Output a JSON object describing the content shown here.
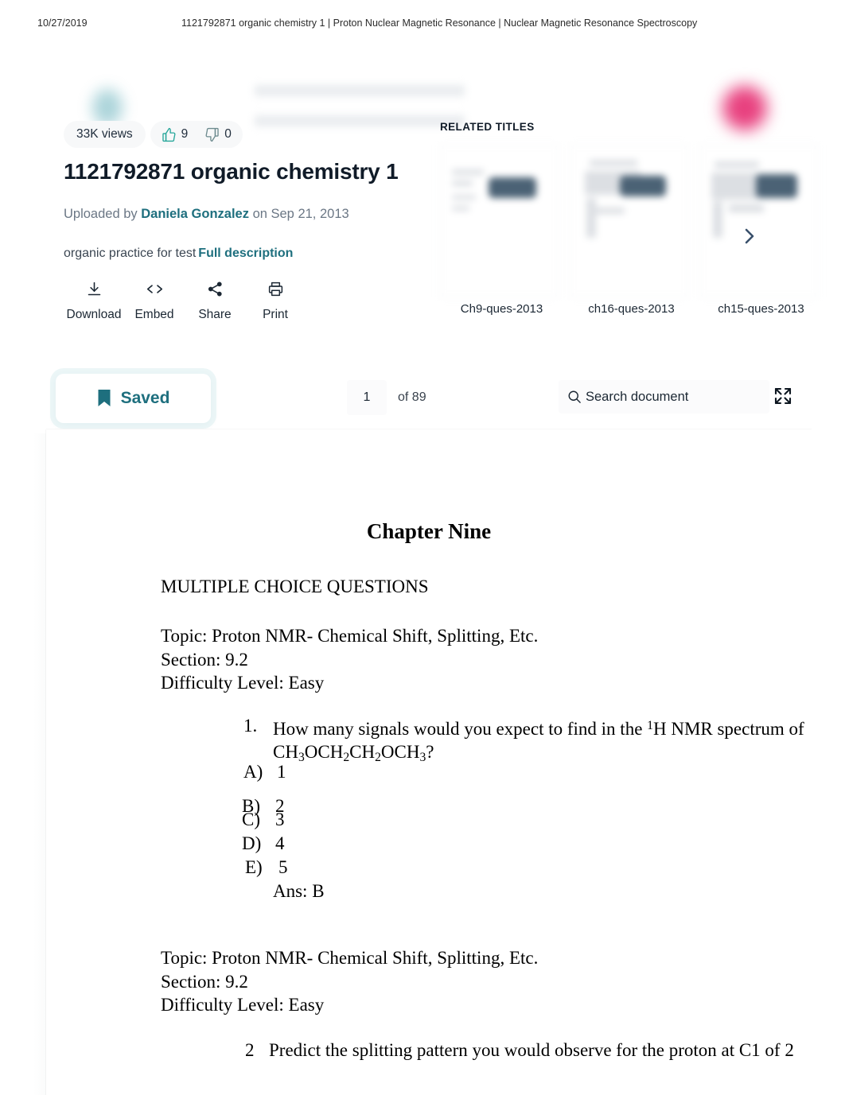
{
  "print_header": {
    "date": "10/27/2019",
    "title": "1121792871 organic chemistry 1 | Proton Nuclear Magnetic Resonance | Nuclear Magnetic Resonance Spectroscopy"
  },
  "stats": {
    "views": "33K views",
    "likes": "9",
    "dislikes": "0"
  },
  "document": {
    "title": "1121792871 organic chemistry 1",
    "uploaded_prefix": "Uploaded by",
    "author": "Daniela Gonzalez",
    "uploaded_suffix": "on Sep 21, 2013",
    "description": "organic practice for test",
    "full_description_link": "Full description"
  },
  "actions": [
    {
      "label": "Download",
      "icon": "download-icon"
    },
    {
      "label": "Embed",
      "icon": "code-icon"
    },
    {
      "label": "Share",
      "icon": "share-icon"
    },
    {
      "label": "Print",
      "icon": "printer-icon"
    }
  ],
  "related": {
    "heading": "RELATED TITLES",
    "items": [
      {
        "caption": "Ch9-ques-2013"
      },
      {
        "caption": "ch16-ques-2013"
      },
      {
        "caption": "ch15-ques-2013"
      }
    ],
    "next_icon": "chevron-right-icon"
  },
  "toolbar": {
    "saved_label": "Saved",
    "saved_icon": "bookmark-filled-icon",
    "page_number": "1",
    "page_total": "of 89",
    "search_placeholder": "Search document",
    "search_icon": "search-icon",
    "fullscreen_icon": "fullscreen-icon"
  },
  "page_content": {
    "chapter_title": "Chapter Nine",
    "section_heading": "MULTIPLE CHOICE QUESTIONS",
    "topic_block_1": {
      "topic": "Topic: Proton NMR- Chemical Shift, Splitting, Etc.",
      "section": "Section: 9.2",
      "difficulty": "Difficulty Level: Easy"
    },
    "question_1": {
      "number": "1.",
      "text_part_1": "How many signals would you expect to find in the ",
      "sup_1": "1",
      "text_part_2": "H NMR spectrum of CH",
      "sub_1": "3",
      "text_part_3": "OCH",
      "sub_2": "2",
      "text_part_4": "CH",
      "sub_3": "2",
      "text_part_5": "OCH",
      "sub_4": "3",
      "text_part_6": "?",
      "choices": [
        {
          "key": "A)",
          "value": "1"
        },
        {
          "key": "B)",
          "value": "2"
        },
        {
          "key": "C)",
          "value": "3"
        },
        {
          "key": "D)",
          "value": "4"
        },
        {
          "key": "E)",
          "value": "5"
        }
      ],
      "answer": "Ans:  B"
    },
    "topic_block_2": {
      "topic": "Topic: Proton NMR- Chemical Shift, Splitting, Etc.",
      "section": "Section: 9.2",
      "difficulty": "Difficulty Level: Easy"
    },
    "question_2": {
      "number": "2",
      "text": "Predict the splitting pattern you would observe for the proton at C1 of 2"
    }
  },
  "colors": {
    "teal": "#1e6f7e",
    "like_green": "#26a69a",
    "avatar_pink": "#e8417f",
    "chevron_navy": "#39506b",
    "text_dark": "#101b28"
  }
}
